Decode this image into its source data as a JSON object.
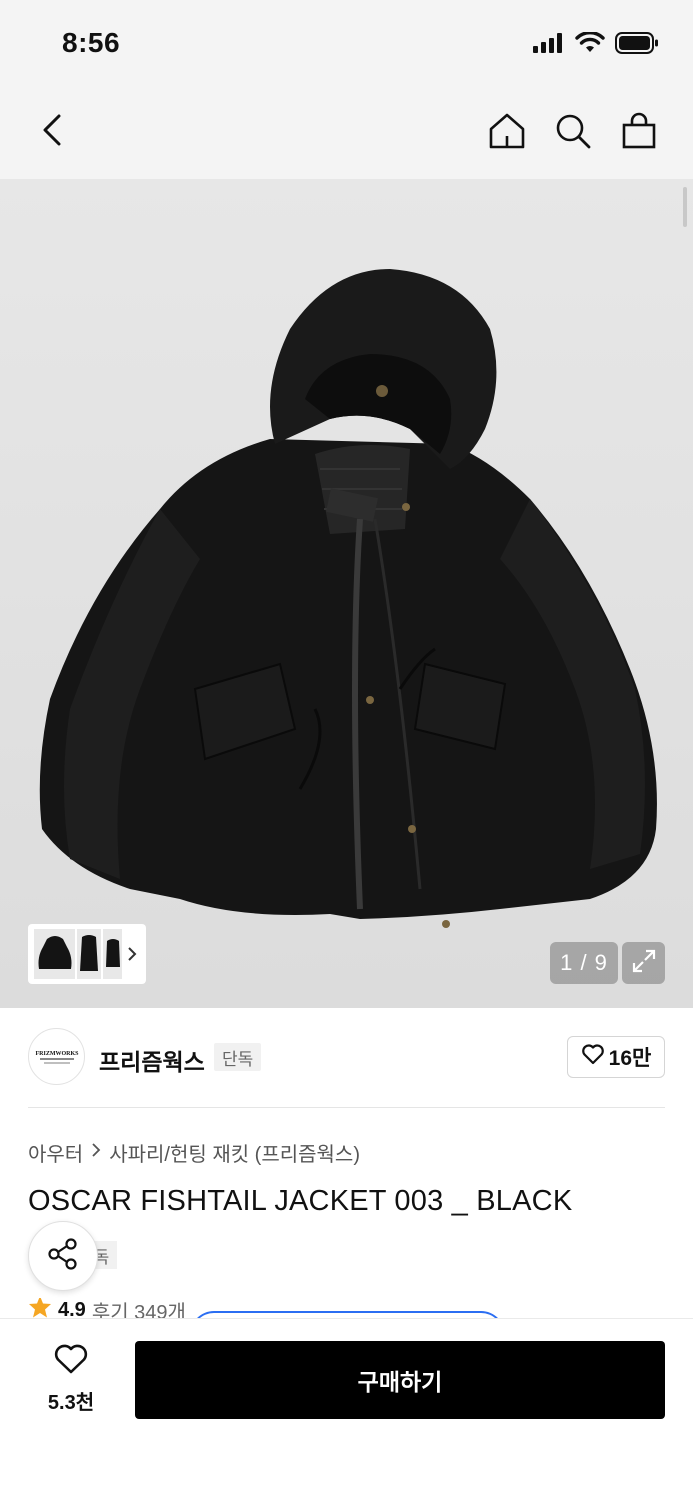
{
  "status_bar": {
    "time": "8:56",
    "icons": [
      "signal-icon",
      "wifi-icon",
      "battery-icon"
    ]
  },
  "nav": {
    "icons": [
      "back-icon",
      "home-icon",
      "search-icon",
      "cart-icon"
    ]
  },
  "gallery": {
    "counter": "1 / 9",
    "thumbnail_count": 3
  },
  "brand": {
    "name": "프리즘웍스",
    "badge": "단독",
    "likes": "16만",
    "logo_text": "FRIZMWORKS"
  },
  "product": {
    "breadcrumb_category": "아우터",
    "breadcrumb_sub": "사파리/헌팅 재킷 (프리즘웍스)",
    "title": "OSCAR FISHTAIL JACKET 003 _ BLACK",
    "badge": "단독",
    "rating": "4.9",
    "reviews": "후기 349개"
  },
  "bottom": {
    "wish_count": "5.3천",
    "buy_label": "구매하기"
  },
  "colors": {
    "accent": "#000000",
    "rating_star": "#f5a623",
    "peek_border": "#2b6ef2"
  }
}
